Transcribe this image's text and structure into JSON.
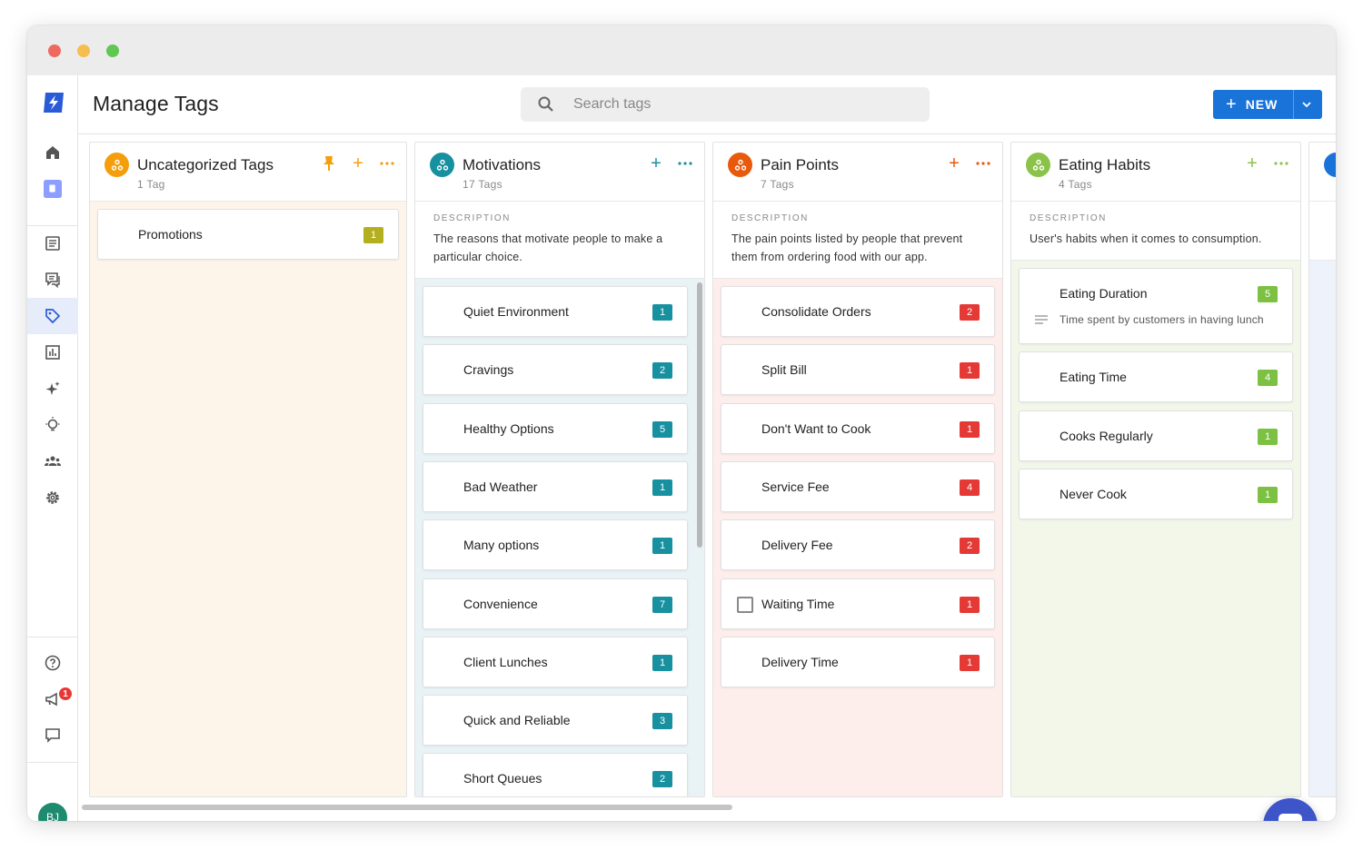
{
  "app": {
    "title": "Manage Tags",
    "search_placeholder": "Search tags",
    "new_button": "NEW",
    "notification_count": "1",
    "user_initials": "BJ"
  },
  "sidebar": {
    "top_icons": [
      "home-icon",
      "book-icon"
    ],
    "nav_icons": [
      "document-list-icon",
      "chat-bubbles-icon",
      "tag-icon",
      "bar-chart-icon",
      "sparkle-icon",
      "lightbulb-icon",
      "people-icon",
      "gear-icon"
    ],
    "active": "tag-icon",
    "bottom_icons": [
      "help-icon",
      "megaphone-icon",
      "feedback-icon"
    ]
  },
  "colors": {
    "uncategorized": "#f59e0b",
    "motivations": "#17909f",
    "pain_points": "#e8590c",
    "eating_habits": "#8bc34a",
    "badge_olive": "#b3b020",
    "badge_teal": "#17909f",
    "badge_red": "#e53935",
    "badge_green": "#7cc142",
    "accent": "#1a73d9"
  },
  "columns": [
    {
      "title": "Uncategorized Tags",
      "count": "1 Tag",
      "description_label": "",
      "description": "",
      "tags": [
        {
          "label": "Promotions",
          "count": "1"
        }
      ]
    },
    {
      "title": "Motivations",
      "count": "17 Tags",
      "description_label": "DESCRIPTION",
      "description": "The reasons that motivate people to make a particular choice.",
      "tags": [
        {
          "label": "Quiet Environment",
          "count": "1"
        },
        {
          "label": "Cravings",
          "count": "2"
        },
        {
          "label": "Healthy Options",
          "count": "5"
        },
        {
          "label": "Bad Weather",
          "count": "1"
        },
        {
          "label": "Many options",
          "count": "1"
        },
        {
          "label": "Convenience",
          "count": "7"
        },
        {
          "label": "Client Lunches",
          "count": "1"
        },
        {
          "label": "Quick and Reliable",
          "count": "3"
        },
        {
          "label": "Short Queues",
          "count": "2"
        }
      ]
    },
    {
      "title": "Pain Points",
      "count": "7 Tags",
      "description_label": "DESCRIPTION",
      "description": "The pain points listed by people that prevent them from ordering food with our app.",
      "tags": [
        {
          "label": "Consolidate Orders",
          "count": "2"
        },
        {
          "label": "Split Bill",
          "count": "1"
        },
        {
          "label": "Don't Want to Cook",
          "count": "1"
        },
        {
          "label": "Service Fee",
          "count": "4"
        },
        {
          "label": "Delivery Fee",
          "count": "2"
        },
        {
          "label": "Waiting Time",
          "count": "1"
        },
        {
          "label": "Delivery Time",
          "count": "1"
        }
      ]
    },
    {
      "title": "Eating Habits",
      "count": "4 Tags",
      "description_label": "DESCRIPTION",
      "description": "User's habits when it comes to consumption.",
      "tags": [
        {
          "label": "Eating Duration",
          "count": "5",
          "subtitle": "Time spent by customers in having lunch"
        },
        {
          "label": "Eating Time",
          "count": "4"
        },
        {
          "label": "Cooks Regularly",
          "count": "1"
        },
        {
          "label": "Never Cook",
          "count": "1"
        }
      ]
    }
  ]
}
